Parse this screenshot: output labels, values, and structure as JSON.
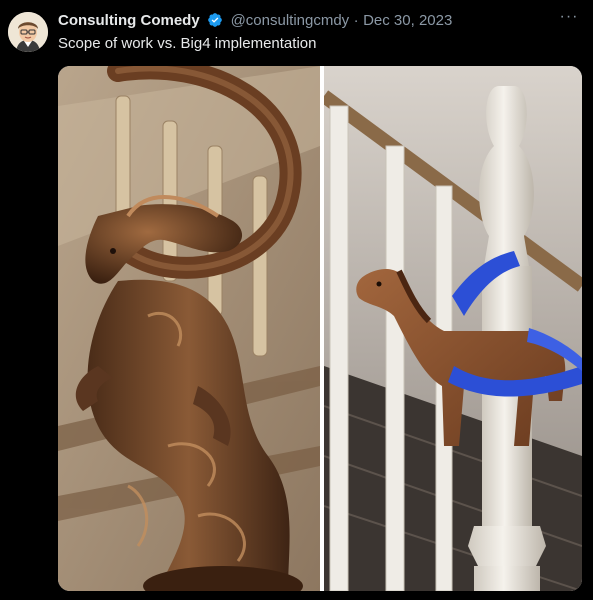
{
  "author": {
    "name": "Consulting Comedy",
    "handle": "@consultingcmdy",
    "dot": "·",
    "date": "Dec 30, 2023"
  },
  "tweet": {
    "text": "Scope of work vs. Big4 implementation"
  },
  "icons": {
    "verified": "verified-badge-icon",
    "more": "more-options-icon",
    "avatar": "cartoon-avatar"
  },
  "colors": {
    "background": "#000000",
    "primary_text": "#e7e9ea",
    "secondary_text": "#8b98a5",
    "verified": "#1d9bf0"
  }
}
